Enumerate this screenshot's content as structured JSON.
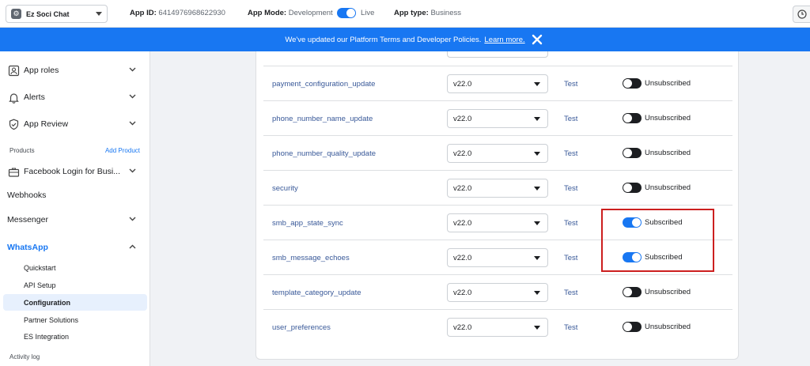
{
  "topbar": {
    "app_name": "Ez Soci Chat",
    "app_id_label": "App ID:",
    "app_id_value": "6414976968622930",
    "mode_label": "App Mode:",
    "mode_value": "Development",
    "live_label": "Live",
    "type_label": "App type:",
    "type_value": "Business"
  },
  "banner": {
    "text": "We've updated our Platform Terms and Developer Policies.",
    "link": "Learn more."
  },
  "sidebar": {
    "app_roles": "App roles",
    "alerts": "Alerts",
    "app_review": "App Review",
    "products_label": "Products",
    "add_product": "Add Product",
    "fb_login": "Facebook Login for Busi...",
    "webhooks": "Webhooks",
    "messenger": "Messenger",
    "whatsapp": "WhatsApp",
    "sub_items": [
      "Quickstart",
      "API Setup",
      "Configuration",
      "Partner Solutions",
      "ES Integration"
    ],
    "activity_log": "Activity log"
  },
  "webhook_fields": [
    {
      "name": "payment_configuration_update",
      "version": "v22.0",
      "test": "Test",
      "status": "Unsubscribed",
      "subscribed": false
    },
    {
      "name": "phone_number_name_update",
      "version": "v22.0",
      "test": "Test",
      "status": "Unsubscribed",
      "subscribed": false
    },
    {
      "name": "phone_number_quality_update",
      "version": "v22.0",
      "test": "Test",
      "status": "Unsubscribed",
      "subscribed": false
    },
    {
      "name": "security",
      "version": "v22.0",
      "test": "Test",
      "status": "Unsubscribed",
      "subscribed": false
    },
    {
      "name": "smb_app_state_sync",
      "version": "v22.0",
      "test": "Test",
      "status": "Subscribed",
      "subscribed": true
    },
    {
      "name": "smb_message_echoes",
      "version": "v22.0",
      "test": "Test",
      "status": "Subscribed",
      "subscribed": true
    },
    {
      "name": "template_category_update",
      "version": "v22.0",
      "test": "Test",
      "status": "Unsubscribed",
      "subscribed": false
    },
    {
      "name": "user_preferences",
      "version": "v22.0",
      "test": "Test",
      "status": "Unsubscribed",
      "subscribed": false
    }
  ],
  "colors": {
    "accent": "#1877f2",
    "link": "#385898",
    "highlight": "#cc1f1f"
  }
}
